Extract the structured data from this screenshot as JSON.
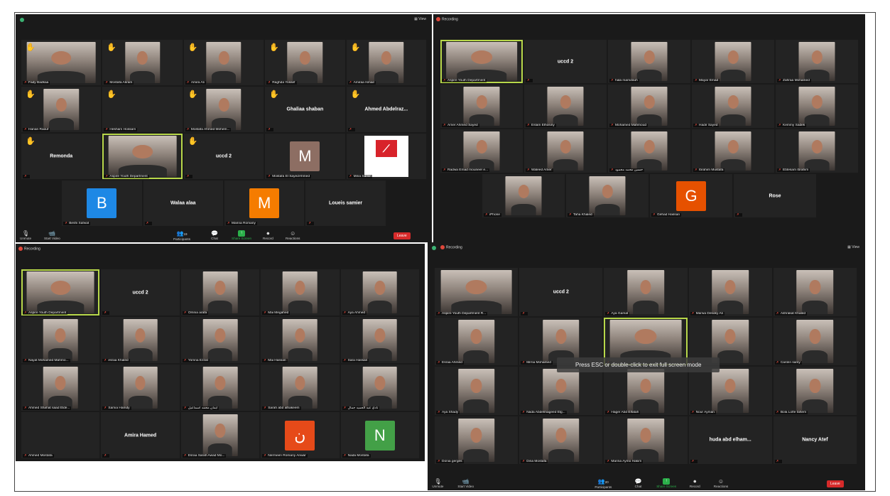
{
  "quadrants": [
    {
      "recording_label": "",
      "view_label": "View",
      "rows": 4,
      "cols": 5,
      "tiles": [
        {
          "name": "Fady Badkaa",
          "type": "video",
          "hand": true
        },
        {
          "name": "Mostafa Akram",
          "type": "video",
          "hand": true
        },
        {
          "name": "Amira Ali",
          "type": "video",
          "hand": true
        },
        {
          "name": "Raghda Yossef",
          "type": "video",
          "hand": true
        },
        {
          "name": "Amiraa Ismail",
          "type": "video",
          "hand": true
        },
        {
          "name": "Hanan Raouf",
          "type": "video",
          "hand": true
        },
        {
          "name": "Hesham Hossam",
          "type": "empty",
          "hand": true
        },
        {
          "name": "Mostafa Ahmed Mohem...",
          "type": "video",
          "hand": true
        },
        {
          "name": "",
          "big": "Ghaliaa shaban",
          "type": "name",
          "hand": true
        },
        {
          "name": "",
          "big": "Ahmed Abdelraz...",
          "type": "name",
          "hand": true
        },
        {
          "name": "",
          "big": "Remonda",
          "type": "name",
          "hand": true
        },
        {
          "name": "Aspire Youth Department",
          "type": "video",
          "active": true
        },
        {
          "name": "",
          "big": "uccd 2",
          "type": "name",
          "hand": true
        },
        {
          "name": "Mostafa El SayedAhmed",
          "type": "avatar",
          "letter": "M",
          "color": "#8d6e63"
        },
        {
          "name": "Mina Samir",
          "type": "aspire"
        },
        {
          "name": "Beshi Safwat",
          "type": "avatar",
          "letter": "B",
          "color": "#1e88e5"
        },
        {
          "name": "",
          "big": "Walaa alaa",
          "type": "name"
        },
        {
          "name": "Marina Romany",
          "type": "avatar",
          "letter": "M",
          "color": "#f57c00"
        },
        {
          "name": "",
          "big": "Loueis samier",
          "type": "name"
        }
      ],
      "toolbar": {
        "unmute": "Unmute",
        "start_video": "Start Video",
        "participants": "Participants",
        "participants_count": "19",
        "chat": "Chat",
        "share": "Share Screen",
        "record": "Record",
        "reactions": "Reactions",
        "leave": "Leave"
      }
    },
    {
      "recording_label": "Recording",
      "view_label": "",
      "tiles": [
        {
          "name": "Aspire Youth Department",
          "type": "video",
          "active": true
        },
        {
          "name": "",
          "big": "uccd 2",
          "type": "name"
        },
        {
          "name": "hala mamdouh",
          "type": "video"
        },
        {
          "name": "Mayar Emad",
          "type": "video"
        },
        {
          "name": "Zahraa Mohamed",
          "type": "video"
        },
        {
          "name": "Amer Ahmed Sayed",
          "type": "video"
        },
        {
          "name": "Eslam Elhosiny",
          "type": "video"
        },
        {
          "name": "Mohamed Mahmoud",
          "type": "video"
        },
        {
          "name": "Hadir Sayed",
          "type": "video"
        },
        {
          "name": "Kemmy Sadek",
          "type": "video"
        },
        {
          "name": "Radwa Emad mouneer e...",
          "type": "video"
        },
        {
          "name": "Waleed Amer",
          "type": "video"
        },
        {
          "name": "حسين محمد محمود",
          "type": "video"
        },
        {
          "name": "Ibrahim Mustafa",
          "type": "video"
        },
        {
          "name": "Ebtesam Ibrahim",
          "type": "video"
        },
        {
          "name": "iPhone",
          "type": "video"
        },
        {
          "name": "Taha Khaled",
          "type": "video"
        },
        {
          "name": "Gehad Hassan",
          "type": "avatar",
          "letter": "G",
          "color": "#e65100"
        },
        {
          "name": "",
          "big": "Rose",
          "type": "name"
        }
      ]
    },
    {
      "recording_label": "Recording",
      "view_label": "",
      "tiles": [
        {
          "name": "Aspire Youth Department",
          "type": "video",
          "active": true
        },
        {
          "name": "",
          "big": "uccd 2",
          "type": "name"
        },
        {
          "name": "Omnia arafa",
          "type": "video"
        },
        {
          "name": "Mai Megahed",
          "type": "video"
        },
        {
          "name": "Aya Ahmed",
          "type": "video"
        },
        {
          "name": "Nayat Mohamed Mahmo...",
          "type": "video"
        },
        {
          "name": "esraa Khaled",
          "type": "video"
        },
        {
          "name": "Yomna Ezzat",
          "type": "video"
        },
        {
          "name": "Mai Hassan",
          "type": "video"
        },
        {
          "name": "Sara Hassan",
          "type": "video"
        },
        {
          "name": "Ahmed Shahat saad Elde...",
          "type": "video"
        },
        {
          "name": "Samia Hamdy",
          "type": "video"
        },
        {
          "name": "ايمان محمد اسماعيل",
          "type": "video"
        },
        {
          "name": "Sarah abd alhakeem",
          "type": "video"
        },
        {
          "name": "نادي عبد الحميد جمال",
          "type": "video"
        },
        {
          "name": "Ahmed Mostafa",
          "type": "empty"
        },
        {
          "name": "",
          "big": "Amira Hamed",
          "type": "name"
        },
        {
          "name": "Esraa Sarah Awad Mo...",
          "type": "video"
        },
        {
          "name": "Nermeen Romany Anwar",
          "type": "avatar",
          "letter": "ن",
          "color": "#e64a19"
        },
        {
          "name": "Nada Mostafa",
          "type": "avatar",
          "letter": "N",
          "color": "#43a047"
        }
      ]
    },
    {
      "recording_label": "Recording",
      "view_label": "View",
      "tiles": [
        {
          "name": "Aspire Youth Department R...",
          "type": "video"
        },
        {
          "name": "",
          "big": "uccd 2",
          "type": "name"
        },
        {
          "name": "Aya Gamal",
          "type": "video"
        },
        {
          "name": "Marwa Desoky Ali",
          "type": "video"
        },
        {
          "name": "Ashrakat Khaled",
          "type": "video"
        },
        {
          "name": "Esraa Ahmed",
          "type": "video"
        },
        {
          "name": "Mirna Mohamed",
          "type": "video"
        },
        {
          "name": "",
          "type": "video",
          "active": true
        },
        {
          "name": "",
          "type": "video"
        },
        {
          "name": "Carolin samy",
          "type": "video"
        },
        {
          "name": "Aya Shady",
          "type": "video"
        },
        {
          "name": "Nada Abdelmageed Elg...",
          "type": "video"
        },
        {
          "name": "Hager Abd Elfatah",
          "type": "video"
        },
        {
          "name": "Nour Ayman",
          "type": "video"
        },
        {
          "name": "Bola Lotfe fahem",
          "type": "video"
        },
        {
          "name": "Donia gerges",
          "type": "video"
        },
        {
          "name": "Dina Mostafa",
          "type": "video"
        },
        {
          "name": "Marina Aymo Hakim",
          "type": "video"
        },
        {
          "name": "",
          "big": "huda abd elham...",
          "type": "name"
        },
        {
          "name": "",
          "big": "Nancy Atef",
          "type": "name"
        }
      ],
      "esc_message": "Press ESC or double-click to exit full screen mode",
      "toolbar": {
        "unmute": "Unmute",
        "start_video": "Start Video",
        "participants": "Participants",
        "participants_count": "20",
        "chat": "Chat",
        "share": "Share Screen",
        "record": "Record",
        "reactions": "Reactions",
        "leave": "Leave"
      }
    }
  ]
}
